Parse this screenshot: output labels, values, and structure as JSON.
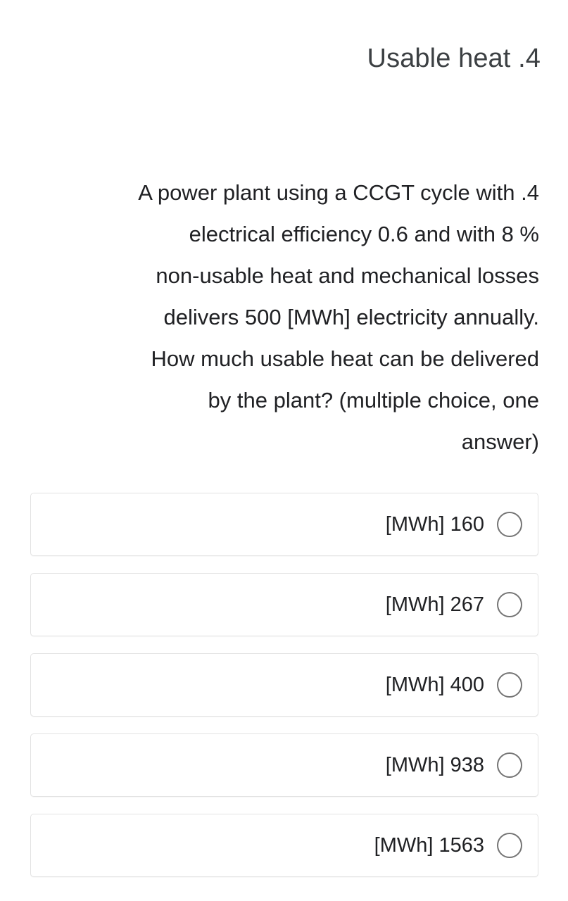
{
  "question": {
    "title": "Usable heat .4",
    "body_lines": [
      "A power plant using a CCGT cycle with .4",
      "electrical efficiency 0.6 and with 8 %",
      "non-usable heat and mechanical losses",
      "delivers 500 [MWh] electricity annually.",
      "How much usable heat can be delivered",
      "by the plant? (multiple choice, one",
      "answer)"
    ]
  },
  "options": [
    {
      "label": "[MWh] 160",
      "radio_icon": "radio-unchecked-icon",
      "selected": false
    },
    {
      "label": "[MWh] 267",
      "radio_icon": "radio-unchecked-icon",
      "selected": false
    },
    {
      "label": "[MWh] 400",
      "radio_icon": "radio-unchecked-icon",
      "selected": false
    },
    {
      "label": "[MWh] 938",
      "radio_icon": "radio-unchecked-icon",
      "selected": false
    },
    {
      "label": "[MWh] 1563",
      "radio_icon": "radio-unchecked-icon",
      "selected": false
    }
  ],
  "colors": {
    "page_background": "#ffffff",
    "title_text": "#3c4043",
    "body_text": "#202124",
    "card_border": "#e3e3e3",
    "radio_border": "#747474"
  }
}
